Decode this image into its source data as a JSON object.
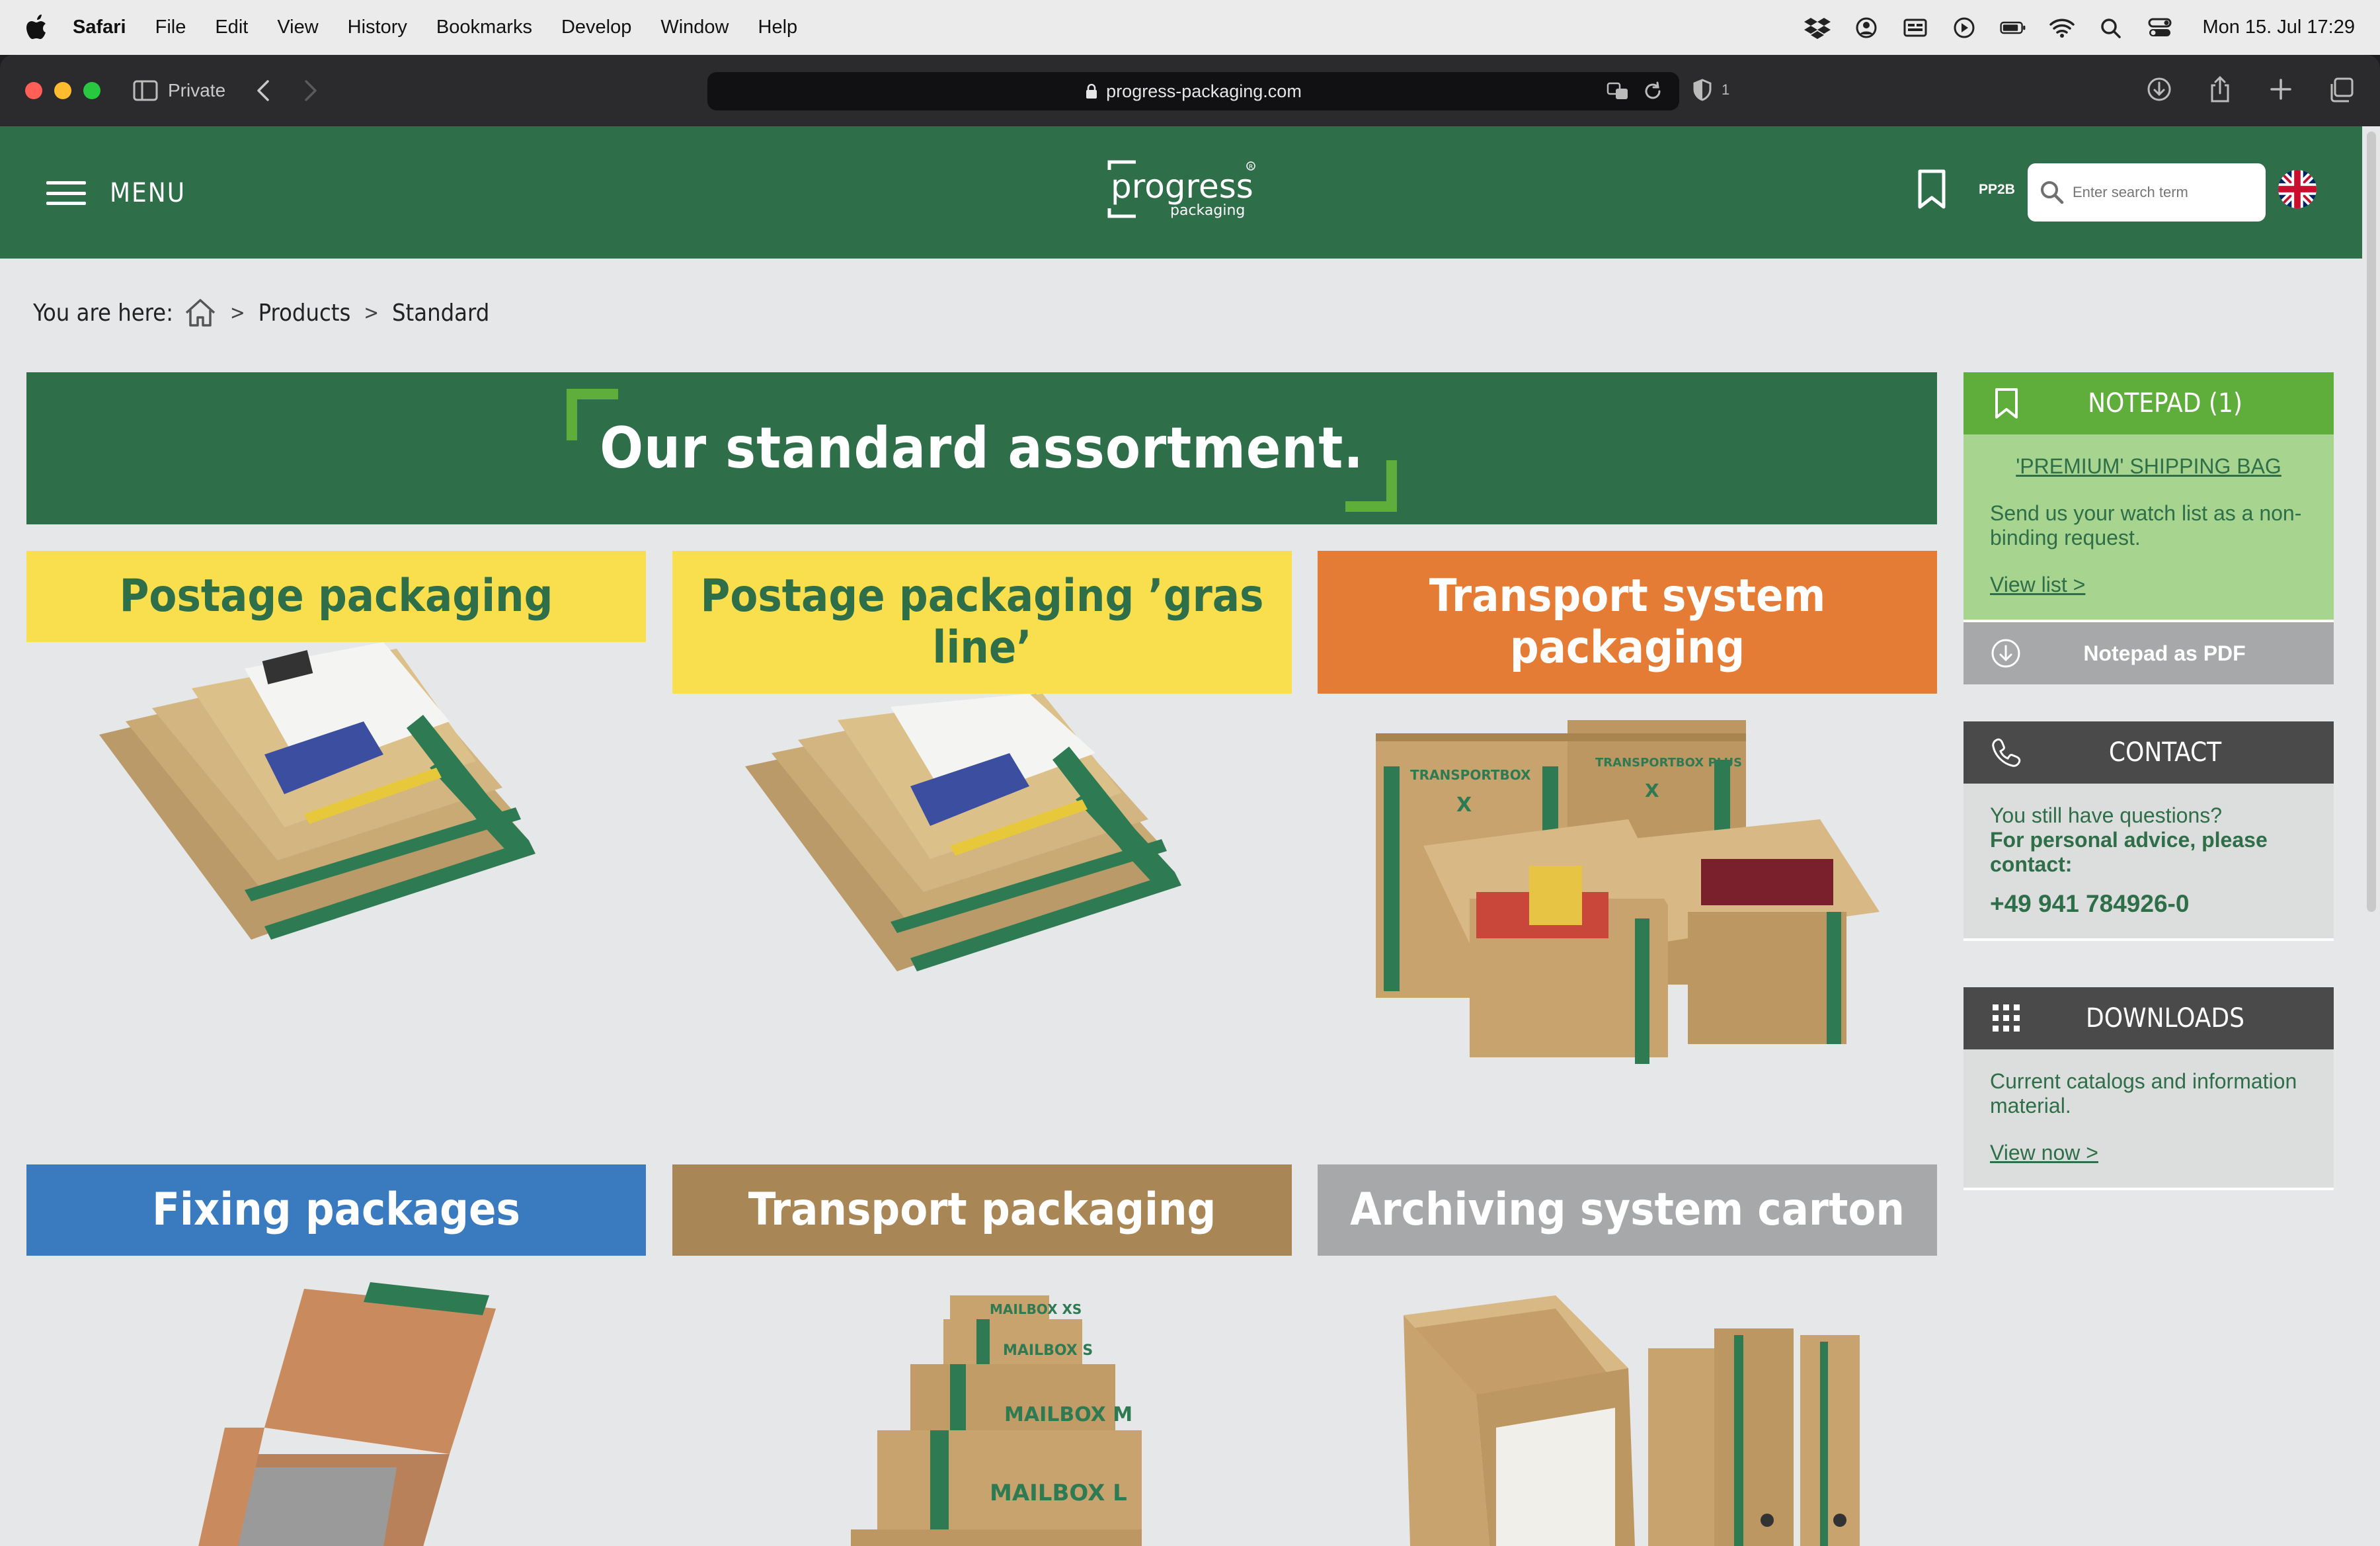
{
  "menubar": {
    "app": "Safari",
    "items": [
      "File",
      "Edit",
      "View",
      "History",
      "Bookmarks",
      "Develop",
      "Window",
      "Help"
    ],
    "clock": "Mon 15. Jul  17:29"
  },
  "toolbar": {
    "private_label": "Private",
    "url": "progress-packaging.com",
    "tracker_count": "1"
  },
  "header": {
    "menu_label": "MENU",
    "logo_text": "progress",
    "logo_sub": "packaging",
    "pp2b_label": "PP2B",
    "search_placeholder": "Enter search term",
    "colors": {
      "header_green": "#2e6e49",
      "accent_green": "#5fae3c"
    }
  },
  "breadcrumb": {
    "prefix": "You are here:",
    "items": [
      "Products",
      "Standard"
    ]
  },
  "hero": {
    "title": "Our standard assortment."
  },
  "products": [
    {
      "title": "Postage packaging",
      "bg": "#f9df4d",
      "fg": "#2e6e49"
    },
    {
      "title": "Postage packaging ’gras line’",
      "bg": "#f9df4d",
      "fg": "#2e6e49"
    },
    {
      "title": "Transport system packaging",
      "bg": "#e57c35",
      "fg": "#ffffff"
    },
    {
      "title": "Fixing packages",
      "bg": "#3a7bbf",
      "fg": "#ffffff"
    },
    {
      "title": "Transport packaging",
      "bg": "#a98655",
      "fg": "#ffffff"
    },
    {
      "title": "Archiving system carton",
      "bg": "#a6a8a9",
      "fg": "#ffffff"
    }
  ],
  "box_labels": {
    "transportbox": "TRANSPORTBOX",
    "transportbox_plus": "TRANSPORTBOX PLUS",
    "x": "X",
    "mailbox_xs": "MAILBOX XS",
    "mailbox_s": "MAILBOX S",
    "mailbox_m": "MAILBOX M",
    "mailbox_l": "MAILBOX L"
  },
  "sidebar": {
    "notepad": {
      "title": "NOTEPAD (1)",
      "item": "'PREMIUM' SHIPPING BAG",
      "text": "Send us your watch list as a non-binding request.",
      "link": "View list >"
    },
    "pdf": {
      "label": "Notepad as PDF"
    },
    "contact": {
      "title": "CONTACT",
      "q": "You still have questions?",
      "advice": "For personal advice, please contact:",
      "phone": "+49 941 784926-0"
    },
    "downloads": {
      "title": "DOWNLOADS",
      "text": "Current catalogs and information material.",
      "link": "View now >"
    }
  }
}
